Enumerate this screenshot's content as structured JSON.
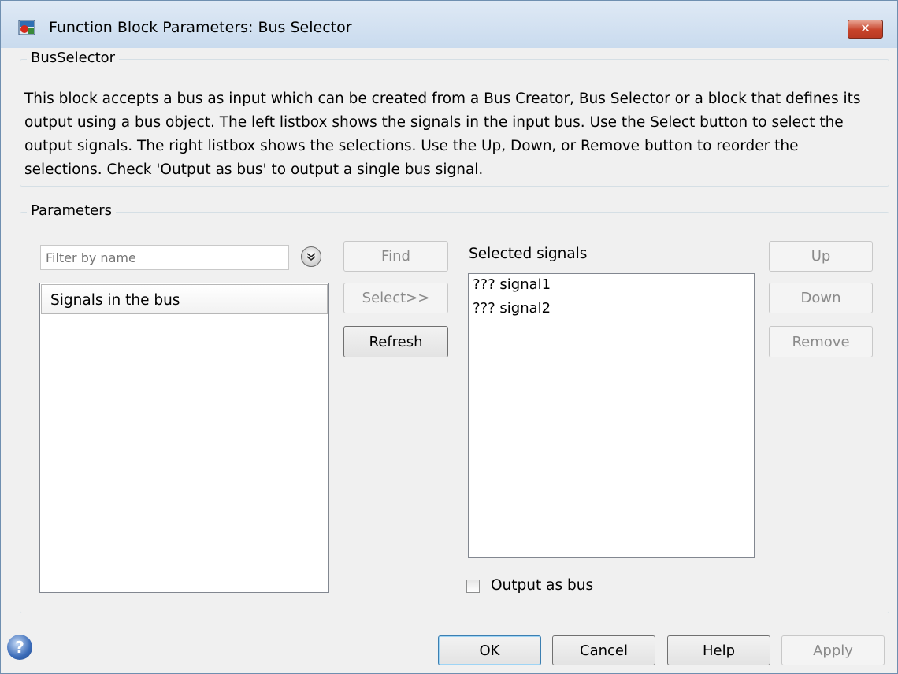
{
  "window": {
    "title": "Function Block Parameters: Bus Selector",
    "close_label": "✕"
  },
  "description_group": {
    "legend": "BusSelector",
    "text": "This block accepts a bus as input which can be created from a Bus Creator, Bus Selector or a block that defines its output using a bus object. The left listbox shows the signals in the input bus. Use the Select button to select the output signals. The right listbox shows the selections. Use the Up, Down, or Remove button to reorder the selections. Check 'Output as bus' to output a single bus signal."
  },
  "parameters_group": {
    "legend": "Parameters",
    "filter_placeholder": "Filter by name",
    "filter_options_icon": "chevron-down-circle-icon",
    "find_label": "Find",
    "select_label": "Select>>",
    "refresh_label": "Refresh",
    "signals_header": "Signals in the bus",
    "selected_label": "Selected signals",
    "selected_signals": [
      "??? signal1",
      "??? signal2"
    ],
    "up_label": "Up",
    "down_label": "Down",
    "remove_label": "Remove",
    "output_as_bus_label": "Output as bus",
    "output_as_bus_checked": false
  },
  "footer": {
    "help_icon": "question-mark-icon",
    "ok_label": "OK",
    "cancel_label": "Cancel",
    "help_label": "Help",
    "apply_label": "Apply"
  }
}
